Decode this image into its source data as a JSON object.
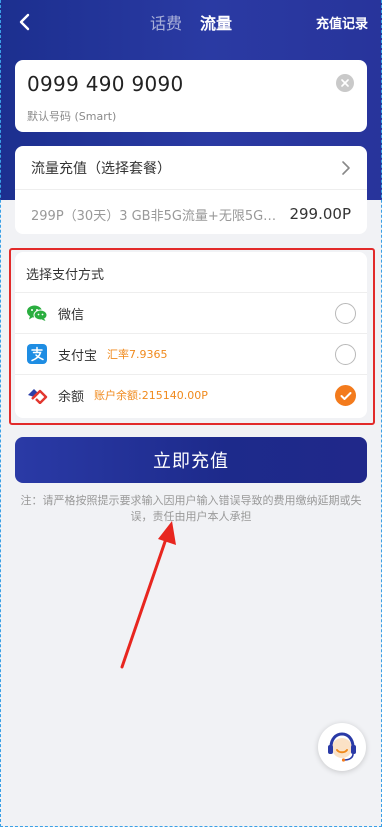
{
  "header": {
    "tabs": [
      {
        "label": "话费",
        "active": false
      },
      {
        "label": "流量",
        "active": true
      }
    ],
    "records_label": "充值记录"
  },
  "phone": {
    "number": "0999 490 9090",
    "sub_label": "默认号码 (Smart)"
  },
  "plan": {
    "title": "流量充值（选择套餐）",
    "description": "299P（30天）3 GB非5G流量+无限5G…",
    "price": "299.00P"
  },
  "payment": {
    "title": "选择支付方式",
    "methods": [
      {
        "label": "微信",
        "extra": "",
        "selected": false,
        "icon": "wechat-icon"
      },
      {
        "label": "支付宝",
        "extra": "汇率7.9365",
        "selected": false,
        "icon": "alipay-icon"
      },
      {
        "label": "余额",
        "extra": "账户余额:215140.00P",
        "selected": true,
        "icon": "balance-icon"
      }
    ]
  },
  "actions": {
    "recharge_label": "立即充值"
  },
  "notice": "注：请严格按照提示要求输入因用户输入错误导致的费用缴纳延期或失误，责任由用户本人承担",
  "colors": {
    "brand": "#25349e",
    "accent_orange": "#f37b1d",
    "highlight_red": "#e22a2a"
  }
}
